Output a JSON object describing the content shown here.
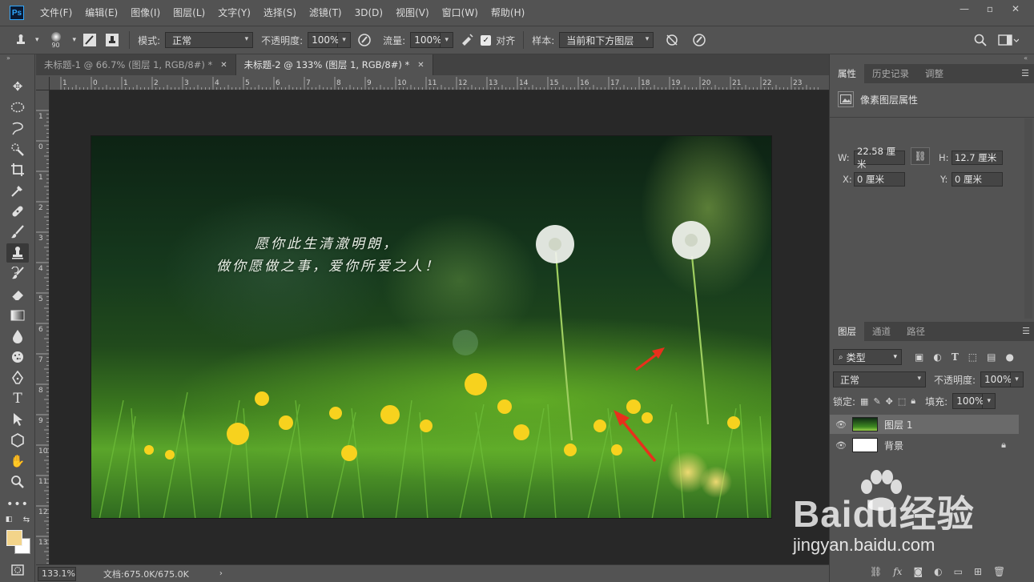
{
  "app": {
    "logo_text": "Ps"
  },
  "menu": [
    "文件(F)",
    "编辑(E)",
    "图像(I)",
    "图层(L)",
    "文字(Y)",
    "选择(S)",
    "滤镜(T)",
    "3D(D)",
    "视图(V)",
    "窗口(W)",
    "帮助(H)"
  ],
  "window_controls": {
    "minimize": "—",
    "maximize": "▫",
    "close": "✕"
  },
  "options": {
    "brush_size": "90",
    "mode_label": "模式:",
    "mode_value": "正常",
    "opacity_label": "不透明度:",
    "opacity_value": "100%",
    "flow_label": "流量:",
    "flow_value": "100%",
    "align_label": "对齐",
    "align_checked": true,
    "sample_label": "样本:",
    "sample_value": "当前和下方图层"
  },
  "tabs": [
    {
      "label": "未标题-1 @ 66.7% (图层 1, RGB/8#) *",
      "active": false
    },
    {
      "label": "未标题-2 @ 133% (图层 1, RGB/8#) *",
      "active": true
    }
  ],
  "ruler_top_labels": [
    "1",
    "0",
    "1",
    "2",
    "3",
    "4",
    "5",
    "6",
    "7",
    "8",
    "9",
    "10",
    "11",
    "12",
    "13",
    "14",
    "15",
    "16",
    "17",
    "18",
    "19",
    "20",
    "21",
    "22",
    "23"
  ],
  "ruler_left_labels": [
    "1",
    "0",
    "1",
    "2",
    "3",
    "4",
    "5",
    "6",
    "7",
    "8",
    "9",
    "10",
    "11",
    "12",
    "13"
  ],
  "canvas": {
    "text_line1": "愿你此生清澈明朗，",
    "text_line2": "做你愿做之事，爱你所爱之人！"
  },
  "status": {
    "zoom": "133.1%",
    "doc_info": "文档:675.0K/675.0K",
    "arrow": "›"
  },
  "properties_panel": {
    "tabs": [
      "属性",
      "历史记录",
      "调整"
    ],
    "header": "像素图层属性",
    "w_label": "W:",
    "w_value": "22.58 厘米",
    "h_label": "H:",
    "h_value": "12.7 厘米",
    "x_label": "X:",
    "x_value": "0 厘米",
    "y_label": "Y:",
    "y_value": "0 厘米"
  },
  "layers_panel": {
    "tabs": [
      "图层",
      "通道",
      "路径"
    ],
    "filter_value": "类型",
    "blend_value": "正常",
    "opacity_label": "不透明度:",
    "opacity_value": "100%",
    "lock_label": "锁定:",
    "fill_label": "填充:",
    "fill_value": "100%",
    "layers": [
      {
        "name": "图层 1",
        "selected": true,
        "locked": false
      },
      {
        "name": "背景",
        "selected": false,
        "locked": true
      }
    ]
  },
  "watermark": {
    "brand": "Baidu经验",
    "url": "jingyan.baidu.com"
  },
  "colors": {
    "foreground": "#f3d48a",
    "background": "#ffffff",
    "ui_base": "#535353",
    "accent_ps": "#31a8ff"
  }
}
